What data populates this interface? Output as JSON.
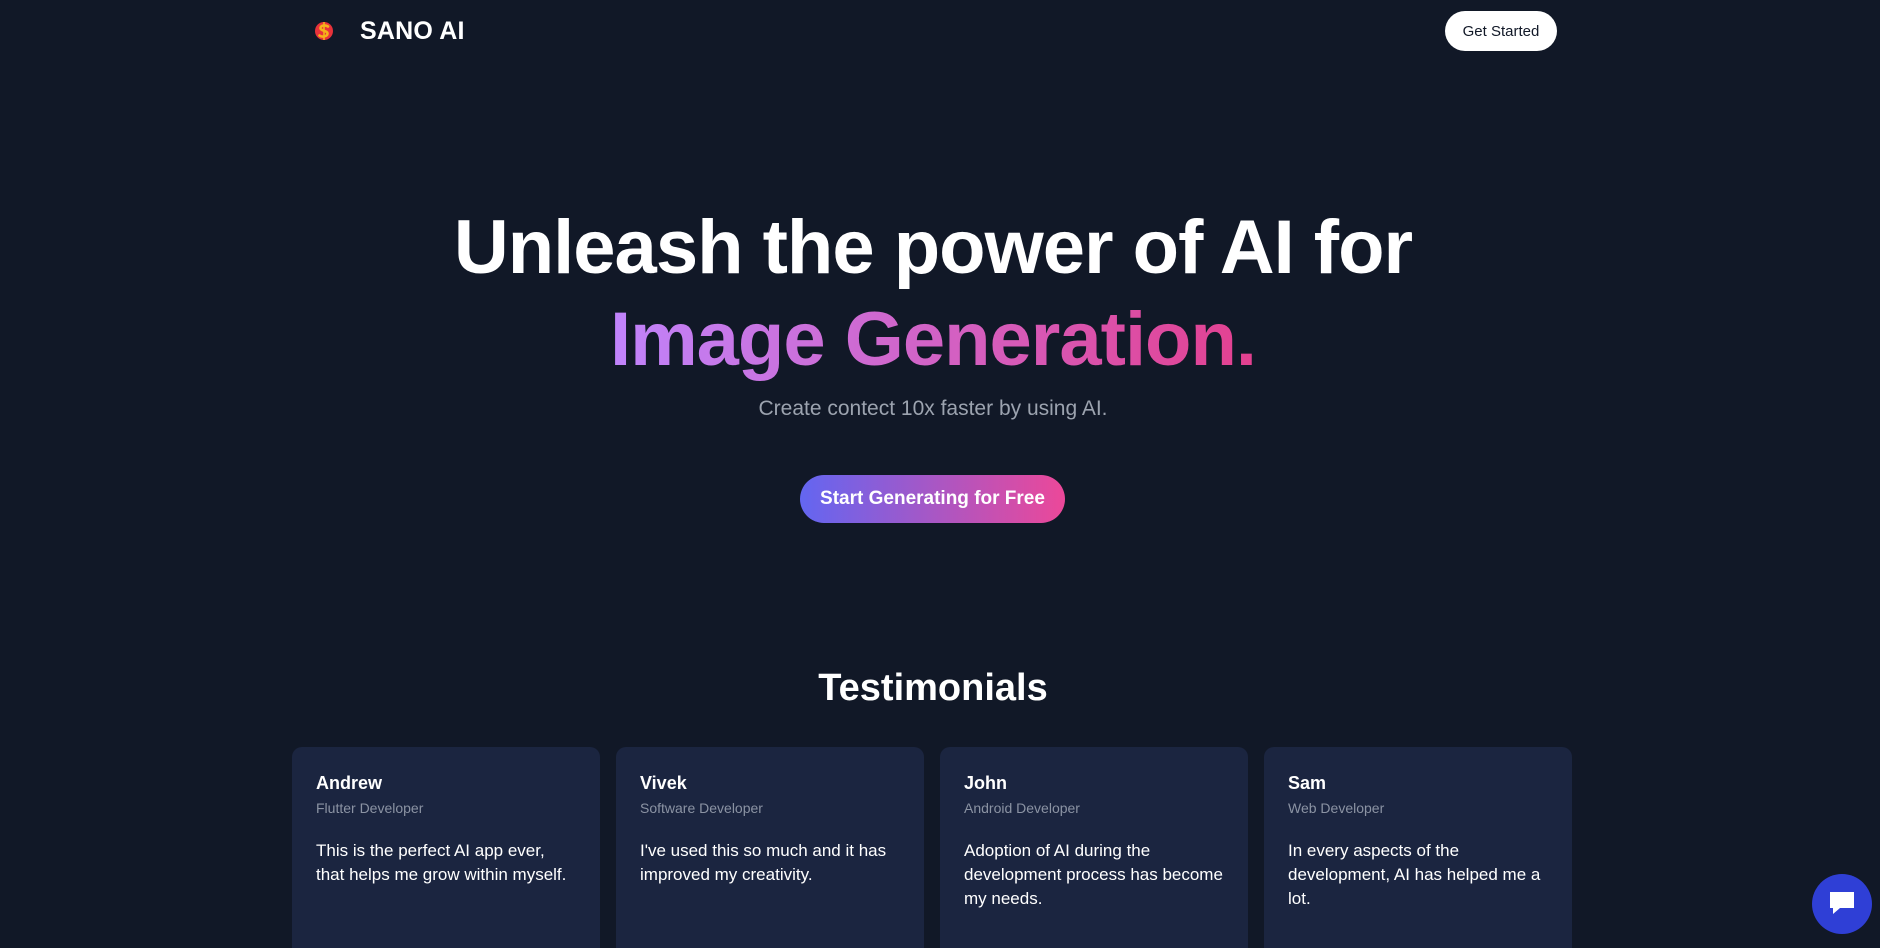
{
  "header": {
    "brand_name": "SANO AI",
    "logo_icon": "sano-logo-icon",
    "get_started_label": "Get Started"
  },
  "hero": {
    "title_line1": "Unleash the power of AI for",
    "title_line2": "Image Generation.",
    "subtitle": "Create contect 10x faster by using AI.",
    "cta_label": "Start Generating for Free"
  },
  "testimonials": {
    "title": "Testimonials",
    "items": [
      {
        "name": "Andrew",
        "role": "Flutter Developer",
        "quote": "This is the perfect AI app ever, that helps me grow within myself."
      },
      {
        "name": "Vivek",
        "role": "Software Developer",
        "quote": "I've used this so much and it has improved my creativity."
      },
      {
        "name": "John",
        "role": "Android Developer",
        "quote": "Adoption of AI during the development process has become my needs."
      },
      {
        "name": "Sam",
        "role": "Web Developer",
        "quote": "In every aspects of the development, AI has helped me a lot."
      }
    ]
  },
  "chat": {
    "icon": "chat-icon"
  },
  "colors": {
    "background": "#111827",
    "card": "#1b2540",
    "gradient_start": "#6366f1",
    "gradient_end": "#ec4899",
    "chat_button": "#2f3fd6"
  }
}
